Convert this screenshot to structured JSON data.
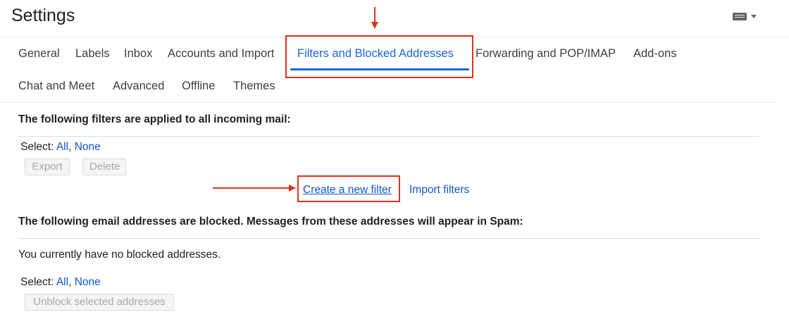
{
  "header": {
    "title": "Settings",
    "keyboard_icon": "keyboard-icon"
  },
  "tabs": [
    {
      "label": "General"
    },
    {
      "label": "Labels"
    },
    {
      "label": "Inbox"
    },
    {
      "label": "Accounts and Import"
    },
    {
      "label": "Filters and Blocked Addresses",
      "active": true
    },
    {
      "label": "Forwarding and POP/IMAP"
    },
    {
      "label": "Add-ons"
    },
    {
      "label": "Chat and Meet"
    },
    {
      "label": "Advanced"
    },
    {
      "label": "Offline"
    },
    {
      "label": "Themes"
    }
  ],
  "filters": {
    "heading": "The following filters are applied to all incoming mail:",
    "select_label": "Select:",
    "select_all": "All",
    "select_sep": ",",
    "select_none": "None",
    "export_label": "Export",
    "delete_label": "Delete",
    "create_link": "Create a new filter",
    "import_link": "Import filters"
  },
  "blocked": {
    "heading": "The following email addresses are blocked. Messages from these addresses will appear in Spam:",
    "empty_text": "You currently have no blocked addresses.",
    "select_label": "Select:",
    "select_all": "All",
    "select_sep": ",",
    "select_none": "None",
    "unblock_label": "Unblock selected addresses"
  },
  "colors": {
    "accent": "#1967d2",
    "link": "#1155cc",
    "annotation": "#e0321c"
  }
}
